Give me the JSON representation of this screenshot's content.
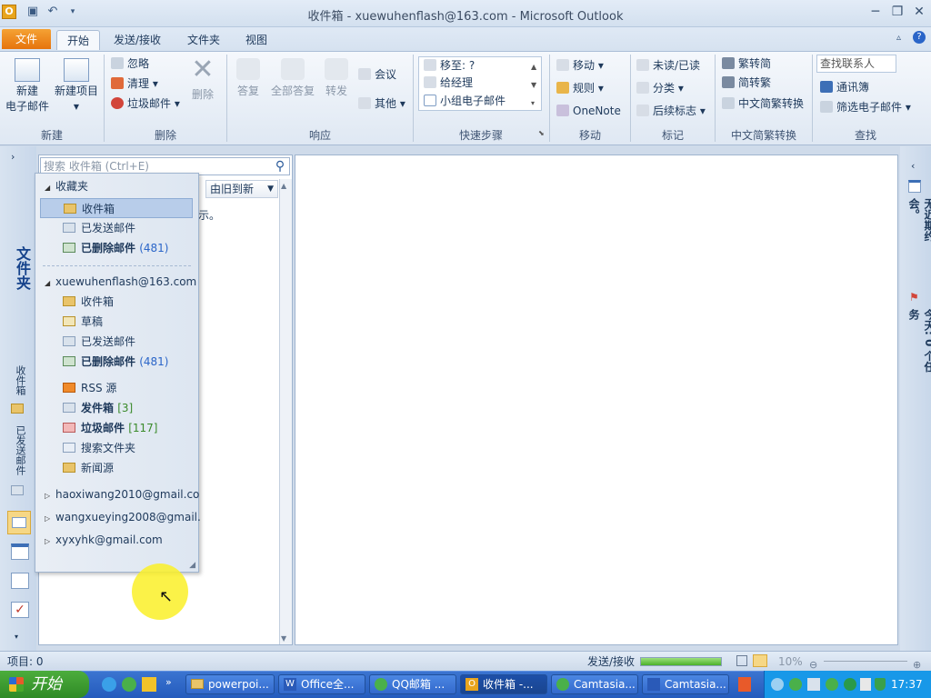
{
  "window": {
    "title": "收件箱 - xuewuhenflash@163.com  -  Microsoft Outlook"
  },
  "tabs": {
    "file": "文件",
    "home": "开始",
    "sendrecv": "发送/接收",
    "folder": "文件夹",
    "view": "视图"
  },
  "ribbon": {
    "new": {
      "new_email_l1": "新建",
      "new_email_l2": "电子邮件",
      "new_items": "新建项目",
      "group": "新建"
    },
    "delete": {
      "ignore": "忽略",
      "cleanup": "清理",
      "junk": "垃圾邮件",
      "delete": "删除",
      "group": "删除"
    },
    "respond": {
      "reply": "答复",
      "reply_all": "全部答复",
      "forward": "转发",
      "meeting": "会议",
      "more": "其他",
      "group": "响应"
    },
    "quicksteps": {
      "move_to": "移至: ?",
      "to_manager": "给经理",
      "team_email": "小组电子邮件",
      "group": "快速步骤"
    },
    "move": {
      "move": "移动",
      "rules": "规则",
      "onenote": "OneNote",
      "group": "移动"
    },
    "tags": {
      "unread_read": "未读/已读",
      "categorize": "分类",
      "followup": "后续标志",
      "group": "标记"
    },
    "chinese": {
      "to_trad": "繁转简",
      "to_simp": "简转繁",
      "convert": "中文简繁转换",
      "group": "中文简繁转换"
    },
    "find": {
      "search_contacts": "查找联系人",
      "address_book": "通讯簿",
      "filter_email": "筛选电子邮件",
      "group": "查找"
    }
  },
  "nav": {
    "folder_label": "文件夹",
    "inbox_short": "收件箱",
    "sent_short": "已发送邮件"
  },
  "list": {
    "search_placeholder": "搜索 收件箱 (Ctrl+E)",
    "sort": "由旧到新",
    "empty_fragment": "示。"
  },
  "folders": {
    "favorites_header": "收藏夹",
    "favorites": [
      {
        "label": "收件箱",
        "count": ""
      },
      {
        "label": "已发送邮件",
        "count": ""
      },
      {
        "label": "已删除邮件",
        "count": "(481)"
      }
    ],
    "account": "xuewuhenflash@163.com",
    "account_folders": [
      {
        "label": "收件箱",
        "count": ""
      },
      {
        "label": "草稿",
        "count": ""
      },
      {
        "label": "已发送邮件",
        "count": ""
      },
      {
        "label": "已删除邮件",
        "count": "(481)"
      },
      {
        "label": "RSS 源",
        "count": ""
      },
      {
        "label": "发件箱",
        "count": "[3]"
      },
      {
        "label": "垃圾邮件",
        "count": "[117]"
      },
      {
        "label": "搜索文件夹",
        "count": ""
      },
      {
        "label": "新闻源",
        "count": ""
      }
    ],
    "other_accounts": [
      "haoxiwang2010@gmail.co",
      "wangxueying2008@gmail.",
      "xyxyhk@gmail.com"
    ]
  },
  "rightbar": {
    "appointments": "无近期约会。",
    "tasks": "今天: 0 个任务"
  },
  "status": {
    "items": "项目: 0",
    "sendrecv": "发送/接收",
    "zoom": "10%"
  },
  "taskbar": {
    "start": "开始",
    "tasks": [
      "powerpoi...",
      "Office全...",
      "QQ邮箱 ...",
      "收件箱 -...",
      "Camtasia...",
      "Camtasia..."
    ],
    "clock": "17:37"
  }
}
